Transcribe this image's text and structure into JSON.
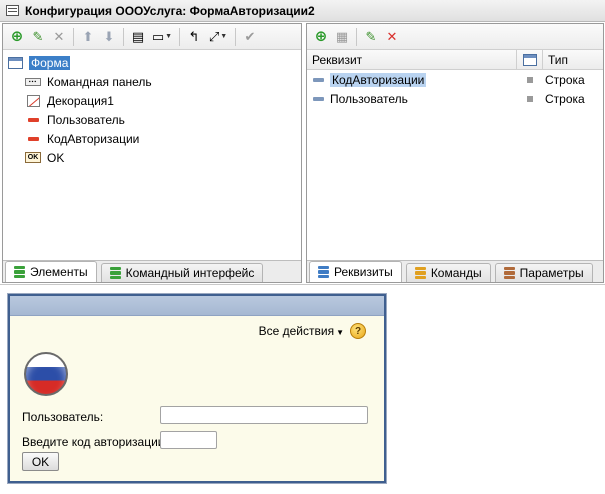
{
  "window": {
    "title": "Конфигурация ОООУслуга: ФормаАвторизации2"
  },
  "elements_panel": {
    "tree": [
      {
        "label": "Форма",
        "icon": "form-icon",
        "level": 0,
        "selected": true
      },
      {
        "label": "Командная панель",
        "icon": "command-panel-icon",
        "level": 1
      },
      {
        "label": "Декорация1",
        "icon": "decoration-icon",
        "level": 1
      },
      {
        "label": "Пользователь",
        "icon": "field-icon",
        "level": 1
      },
      {
        "label": "КодАвторизации",
        "icon": "field-icon",
        "level": 1
      },
      {
        "label": "OK",
        "icon": "button-icon",
        "level": 1
      }
    ],
    "tabs": [
      {
        "label": "Элементы",
        "icon": "elements-tab-icon",
        "active": true
      },
      {
        "label": "Командный интерфейс",
        "icon": "command-interface-tab-icon",
        "active": false
      }
    ]
  },
  "attributes_panel": {
    "columns": {
      "name": "Реквизит",
      "type": "Тип"
    },
    "rows": [
      {
        "name": "КодАвторизации",
        "type": "Строка",
        "selected": true
      },
      {
        "name": "Пользователь",
        "type": "Строка",
        "selected": false
      }
    ],
    "tabs": [
      {
        "label": "Реквизиты",
        "icon": "attributes-tab-icon",
        "active": true
      },
      {
        "label": "Команды",
        "icon": "commands-tab-icon",
        "active": false
      },
      {
        "label": "Параметры",
        "icon": "parameters-tab-icon",
        "active": false
      }
    ]
  },
  "preview": {
    "all_actions": "Все действия",
    "help": "?",
    "user_label": "Пользователь:",
    "user_value": "",
    "code_label": "Введите код авторизации:",
    "code_value": "",
    "ok_label": "OK"
  },
  "colors": {
    "selection": "#3c7fc8",
    "form_background": "#fcfbea",
    "form_header": "#a6b8d2"
  }
}
